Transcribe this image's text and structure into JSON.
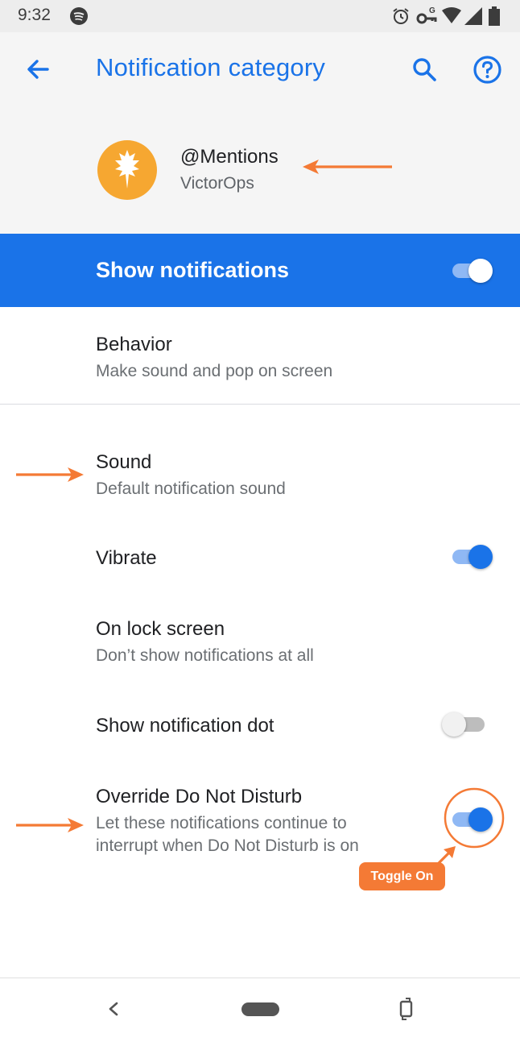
{
  "status_bar": {
    "time": "9:32",
    "icons": [
      "spotify-icon",
      "alarm-icon",
      "vpn-key-icon",
      "wifi-icon",
      "signal-icon",
      "battery-icon"
    ]
  },
  "app_bar": {
    "title": "Notification category",
    "back_icon": "arrow-back-icon",
    "search_icon": "search-icon",
    "help_icon": "help-icon"
  },
  "channel": {
    "name": "@Mentions",
    "app": "VictorOps",
    "icon": "victorops-logo"
  },
  "show_notifications": {
    "label": "Show notifications",
    "enabled": true
  },
  "settings": [
    {
      "title": "Behavior",
      "subtitle": "Make sound and pop on screen"
    },
    {
      "title": "Sound",
      "subtitle": "Default notification sound"
    },
    {
      "title": "Vibrate",
      "toggle": true
    },
    {
      "title": "On lock screen",
      "subtitle": "Don’t show notifications at all"
    },
    {
      "title": "Show notification dot",
      "toggle": false
    },
    {
      "title": "Override Do Not Disturb",
      "subtitle_line1": "Let these notifications continue to",
      "subtitle_line2": "interrupt when Do Not Disturb is on",
      "toggle": true
    }
  ],
  "annotation": {
    "badge_text": "Toggle On",
    "color": "#f47a35"
  },
  "colors": {
    "accent": "#1a73e8",
    "annotation": "#f47a35"
  },
  "nav_bar": {
    "back_icon": "nav-back-icon",
    "home_icon": "home-pill-icon",
    "rotate_icon": "rotate-icon"
  }
}
